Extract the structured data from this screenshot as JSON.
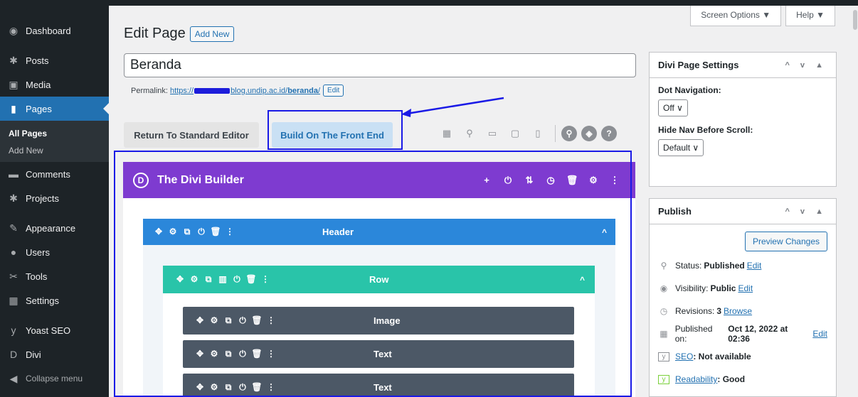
{
  "sidebar": {
    "items": [
      {
        "icon": "dashboard-icon",
        "glyph": "◉",
        "label": "Dashboard"
      },
      {
        "icon": "pin-icon",
        "glyph": "✱",
        "label": "Posts"
      },
      {
        "icon": "media-icon",
        "glyph": "▣",
        "label": "Media"
      },
      {
        "icon": "pages-icon",
        "glyph": "▮",
        "label": "Pages"
      },
      {
        "icon": "comments-icon",
        "glyph": "▬",
        "label": "Comments"
      },
      {
        "icon": "pin-icon",
        "glyph": "✱",
        "label": "Projects"
      },
      {
        "icon": "brush-icon",
        "glyph": "✎",
        "label": "Appearance"
      },
      {
        "icon": "users-icon",
        "glyph": "●",
        "label": "Users"
      },
      {
        "icon": "wrench-icon",
        "glyph": "✂",
        "label": "Tools"
      },
      {
        "icon": "settings-icon",
        "glyph": "▦",
        "label": "Settings"
      },
      {
        "icon": "yoast-icon",
        "glyph": "y",
        "label": "Yoast SEO"
      },
      {
        "icon": "divi-icon",
        "glyph": "D",
        "label": "Divi"
      },
      {
        "icon": "collapse-icon",
        "glyph": "◀",
        "label": "Collapse menu"
      }
    ],
    "submenu": [
      "All Pages",
      "Add New"
    ]
  },
  "header": {
    "screen_options": "Screen Options ▼",
    "help": "Help ▼",
    "title": "Edit Page",
    "add_new": "Add New"
  },
  "editor": {
    "post_title": "Beranda",
    "permalink_label": "Permalink:",
    "permalink_prefix": "https://",
    "permalink_domain": "blog.undip.ac.id/",
    "permalink_slug": "beranda",
    "permalink_suffix": "/",
    "permalink_edit": "Edit",
    "btn_standard": "Return To Standard Editor",
    "btn_front": "Build On The Front End"
  },
  "divi": {
    "title": "The Divi Builder",
    "logo": "D",
    "tools": [
      "+",
      "⏻",
      "⇅",
      "◷",
      "🗑",
      "⚙",
      "⋮"
    ],
    "section_label": "Header",
    "row_label": "Row",
    "modules": [
      "Image",
      "Text",
      "Text"
    ],
    "bar_tools": [
      "✥",
      "⚙",
      "⧉",
      "⏻",
      "🗑",
      "⋮"
    ],
    "row_tools": [
      "✥",
      "⚙",
      "⧉",
      "▥",
      "⏻",
      "🗑",
      "⋮"
    ],
    "chevron": "^"
  },
  "divi_settings": {
    "title": "Divi Page Settings",
    "controls": "^ v ▲",
    "dot_nav_label": "Dot Navigation:",
    "dot_nav_value": "Off ∨",
    "hide_nav_label": "Hide Nav Before Scroll:",
    "hide_nav_value": "Default ∨"
  },
  "publish": {
    "title": "Publish",
    "controls": "^ v ▲",
    "preview": "Preview Changes",
    "status_label": "Status:",
    "status_value": "Published",
    "status_edit": "Edit",
    "visibility_label": "Visibility:",
    "visibility_value": "Public",
    "visibility_edit": "Edit",
    "revisions_label": "Revisions:",
    "revisions_value": "3",
    "revisions_link": "Browse",
    "published_label": "Published on:",
    "published_value": "Oct 12, 2022 at 02:36",
    "published_edit": "Edit",
    "seo_link": "SEO",
    "seo_value": ": Not available",
    "readability_link": "Readability",
    "readability_value": ": Good"
  },
  "colors": {
    "divi_purple": "#7e3bd0",
    "section_blue": "#2b87da",
    "row_teal": "#29c4a9",
    "module_gray": "#4c5866",
    "highlight": "#1a1ae6",
    "wp_blue": "#2271b1"
  }
}
